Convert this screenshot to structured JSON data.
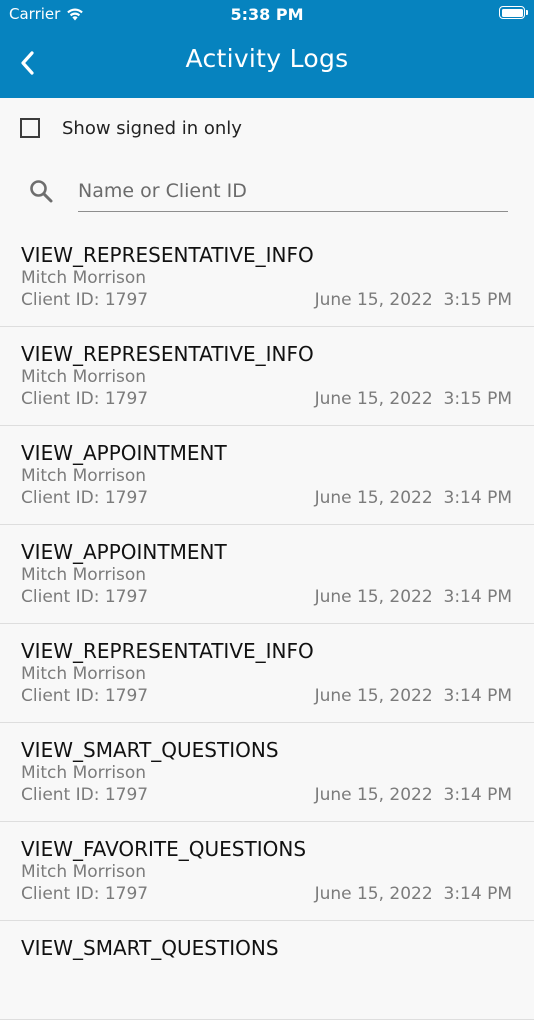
{
  "status_bar": {
    "carrier": "Carrier",
    "time": "5:38 PM"
  },
  "nav": {
    "title": "Activity Logs"
  },
  "filter": {
    "checkbox_label": "Show signed in only",
    "checked": false
  },
  "search": {
    "placeholder": "Name or Client ID",
    "value": ""
  },
  "colors": {
    "header": "#0683bf",
    "background": "#f8f8f8"
  },
  "logs": [
    {
      "action": "VIEW_REPRESENTATIVE_INFO",
      "name": "Mitch Morrison",
      "client": "Client ID: 1797",
      "datetime": "June 15, 2022  3:15 PM"
    },
    {
      "action": "VIEW_REPRESENTATIVE_INFO",
      "name": "Mitch Morrison",
      "client": "Client ID: 1797",
      "datetime": "June 15, 2022  3:15 PM"
    },
    {
      "action": "VIEW_APPOINTMENT",
      "name": "Mitch Morrison",
      "client": "Client ID: 1797",
      "datetime": "June 15, 2022  3:14 PM"
    },
    {
      "action": "VIEW_APPOINTMENT",
      "name": "Mitch Morrison",
      "client": "Client ID: 1797",
      "datetime": "June 15, 2022  3:14 PM"
    },
    {
      "action": "VIEW_REPRESENTATIVE_INFO",
      "name": "Mitch Morrison",
      "client": "Client ID: 1797",
      "datetime": "June 15, 2022  3:14 PM"
    },
    {
      "action": "VIEW_SMART_QUESTIONS",
      "name": "Mitch Morrison",
      "client": "Client ID: 1797",
      "datetime": "June 15, 2022  3:14 PM"
    },
    {
      "action": "VIEW_FAVORITE_QUESTIONS",
      "name": "Mitch Morrison",
      "client": "Client ID: 1797",
      "datetime": "June 15, 2022  3:14 PM"
    },
    {
      "action": "VIEW_SMART_QUESTIONS",
      "name": "",
      "client": "",
      "datetime": ""
    }
  ]
}
